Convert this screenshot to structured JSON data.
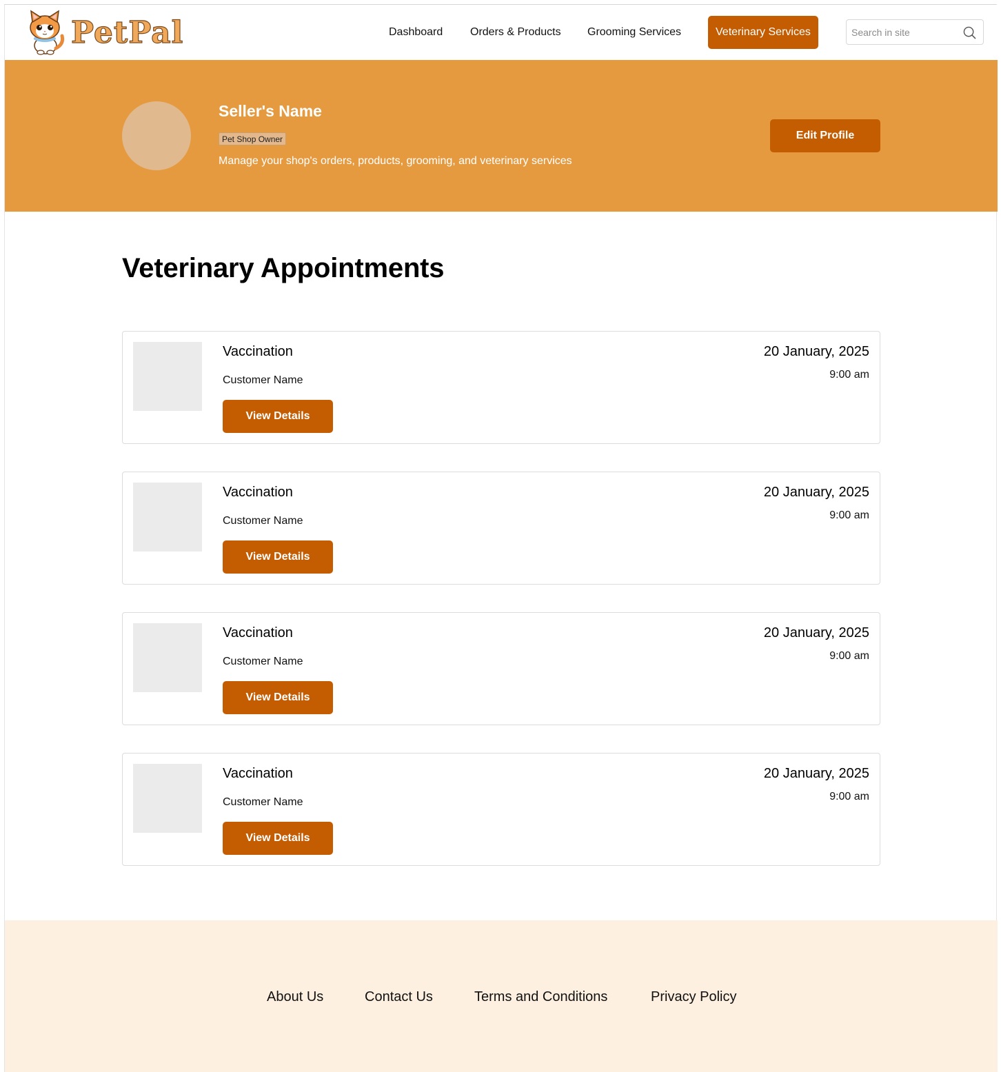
{
  "brand": {
    "name": "PetPal"
  },
  "nav": {
    "items": [
      {
        "label": "Dashboard"
      },
      {
        "label": "Orders & Products"
      },
      {
        "label": "Grooming Services"
      },
      {
        "label": "Veterinary Services"
      }
    ],
    "active": "Veterinary Services"
  },
  "search": {
    "placeholder": "Search in site",
    "value": ""
  },
  "profile": {
    "name": "Seller's Name",
    "role_badge": "Pet Shop Owner",
    "tagline": "Manage your shop's orders, products, grooming, and veterinary services",
    "edit_label": "Edit Profile"
  },
  "main": {
    "title": "Veterinary Appointments",
    "appointments": [
      {
        "service": "Vaccination",
        "customer": "Customer Name",
        "date": "20 January, 2025",
        "time": "9:00 am",
        "action": "View Details"
      },
      {
        "service": "Vaccination",
        "customer": "Customer Name",
        "date": "20 January, 2025",
        "time": "9:00 am",
        "action": "View Details"
      },
      {
        "service": "Vaccination",
        "customer": "Customer Name",
        "date": "20 January, 2025",
        "time": "9:00 am",
        "action": "View Details"
      },
      {
        "service": "Vaccination",
        "customer": "Customer Name",
        "date": "20 January, 2025",
        "time": "9:00 am",
        "action": "View Details"
      }
    ]
  },
  "footer": {
    "links": [
      {
        "label": "About Us"
      },
      {
        "label": "Contact Us"
      },
      {
        "label": "Terms and Conditions"
      },
      {
        "label": "Privacy Policy"
      }
    ]
  },
  "colors": {
    "accent": "#c45c02",
    "banner": "#e69a40",
    "avatar": "#e0b98e",
    "footer_bg": "#fdf0e0",
    "thumb": "#ebebeb"
  },
  "icons": {
    "logo": "cat-mascot-icon",
    "search": "search-icon"
  }
}
